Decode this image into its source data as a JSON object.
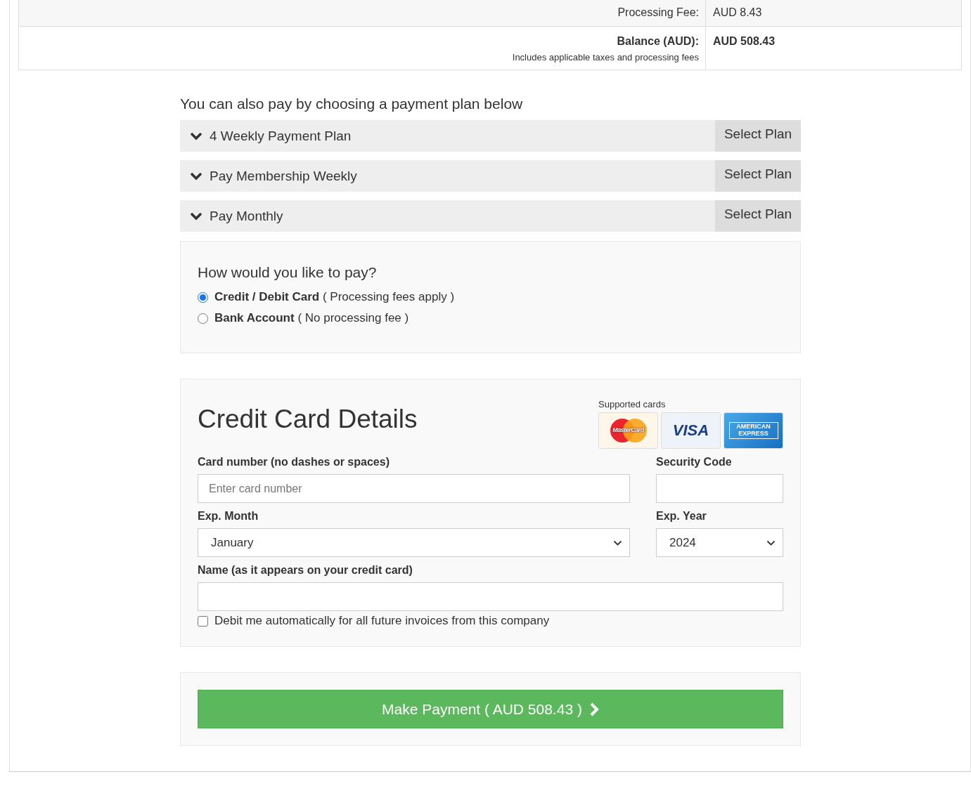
{
  "summary": {
    "rows": [
      {
        "label": "Processing Fee:",
        "value": "AUD 8.43",
        "strong": false
      },
      {
        "label": "Balance (AUD):",
        "note": "Includes applicable taxes and processing fees",
        "value": "AUD 508.43",
        "strong": true
      }
    ]
  },
  "plans": {
    "heading": "You can also pay by choosing a payment plan below",
    "items": [
      {
        "title": "4 Weekly Payment Plan",
        "expanded": false,
        "button": "Select Plan"
      },
      {
        "title": "Pay Membership Weekly",
        "expanded": false,
        "button": "Select Plan"
      },
      {
        "title": "Pay Monthly",
        "expanded": false,
        "button": "Select Plan"
      }
    ]
  },
  "payment_method": {
    "question": "How would you like to pay?",
    "options": [
      {
        "label": "**Credit / Debit Card** ( Processing fees apply )",
        "selected": true
      },
      {
        "label": "**Bank Account** ( No processing fee )",
        "selected": false
      }
    ]
  },
  "card_details": {
    "title": "Credit Card Details",
    "supported_label": "Supported cards",
    "cards": [
      {
        "kind": "mastercard",
        "label": "MasterCard"
      },
      {
        "kind": "visa",
        "label": "VISA"
      },
      {
        "kind": "amex",
        "label": "AMERICAN EXPRESS"
      }
    ],
    "card_number": {
      "label": "Card number (no dashes or spaces)",
      "placeholder": "Enter card number"
    },
    "security_code": {
      "label": "Security Code"
    },
    "exp_month": {
      "label": "Exp. Month",
      "value": "January"
    },
    "exp_year": {
      "label": "Exp. Year",
      "value": "2024"
    },
    "name": {
      "label": "Name (as it appears on your credit card)"
    },
    "auto_debit": {
      "label": "Debit me automatically for all future invoices from this company",
      "checked": false
    }
  },
  "submit": {
    "label": "Make Payment ( AUD 508.43 )"
  }
}
